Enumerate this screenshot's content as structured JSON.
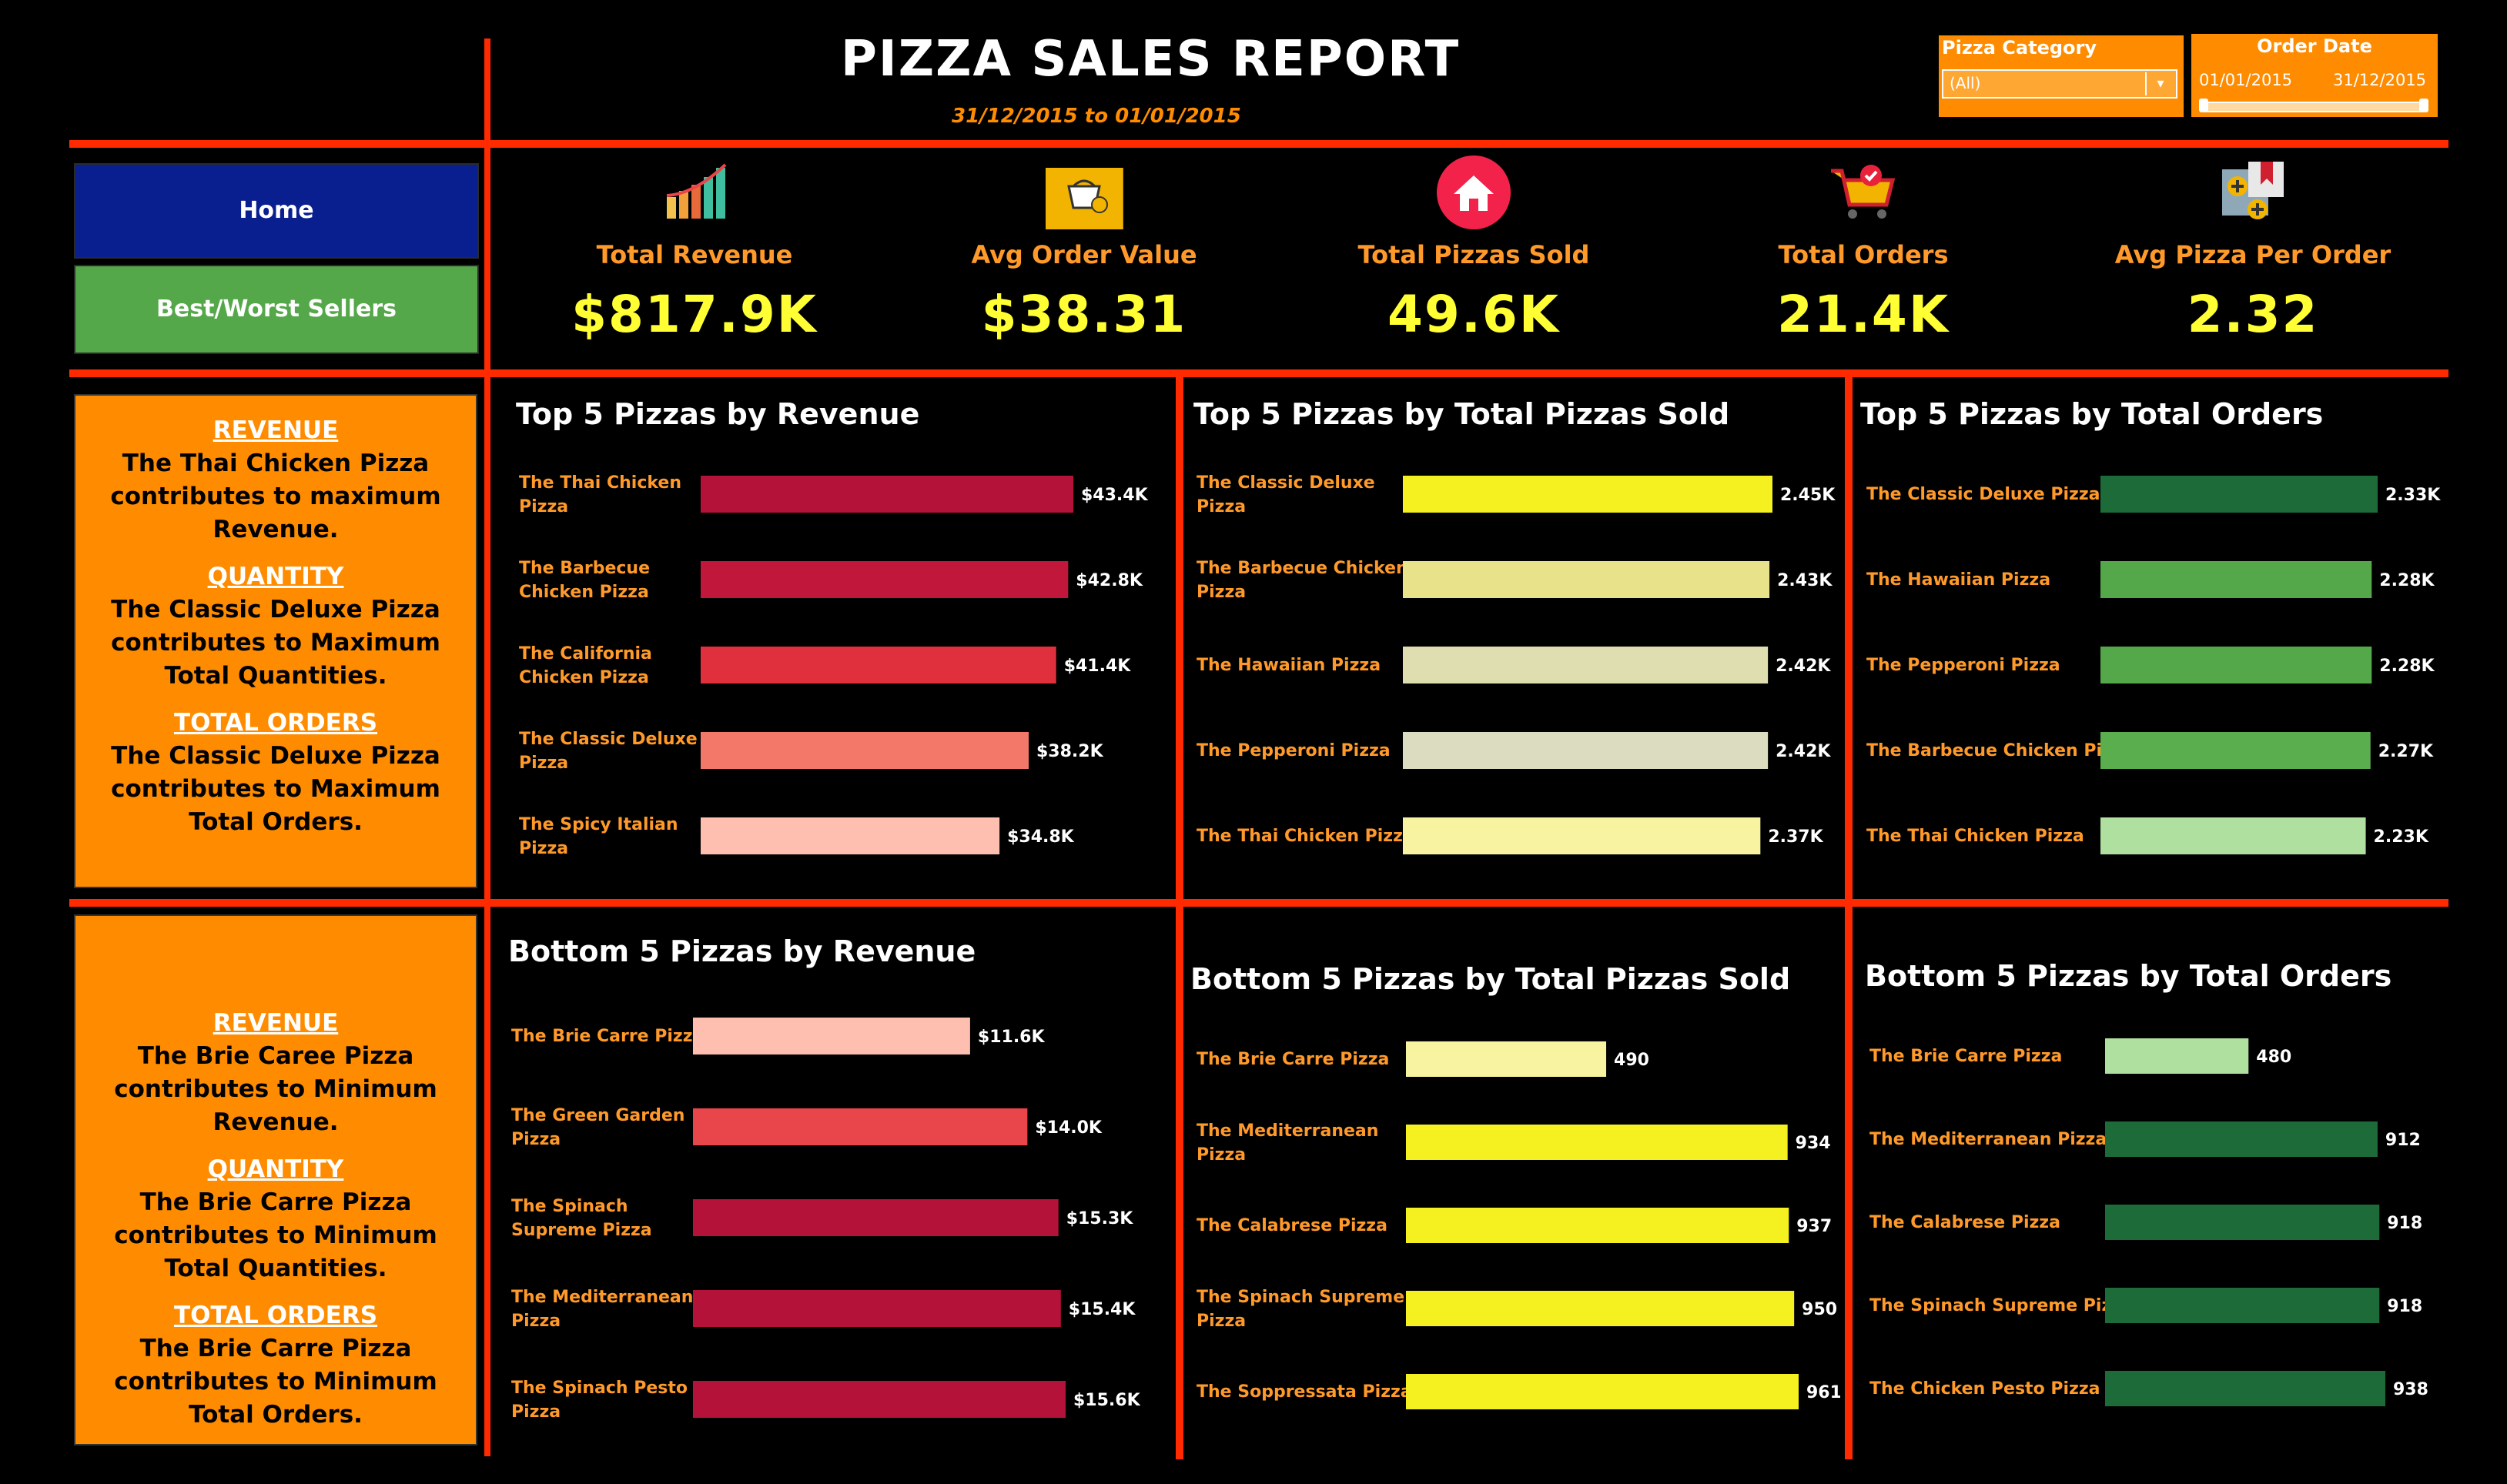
{
  "header": {
    "title": "PIZZA SALES REPORT",
    "date_range": "31/12/2015 to 01/01/2015"
  },
  "filters": {
    "category_label": "Pizza Category",
    "category_value": "(All)",
    "date_label": "Order Date",
    "date_start": "01/01/2015",
    "date_end": "31/12/2015"
  },
  "nav": {
    "home": "Home",
    "best_worst": "Best/Worst Sellers"
  },
  "kpis": [
    {
      "label": "Total Revenue",
      "value": "$817.9K",
      "icon": "bar-chart-icon"
    },
    {
      "label": "Avg Order Value",
      "value": "$38.31",
      "icon": "money-basket-icon"
    },
    {
      "label": "Total Pizzas Sold",
      "value": "49.6K",
      "icon": "home-icon"
    },
    {
      "label": "Total Orders",
      "value": "21.4K",
      "icon": "shopping-cart-icon"
    },
    {
      "label": "Avg Pizza Per Order",
      "value": "2.32",
      "icon": "add-items-icon"
    }
  ],
  "notes_top": {
    "revenue_head": "REVENUE",
    "revenue_text": "The Thai Chicken Pizza contributes to maximum Revenue.",
    "quantity_head": "QUANTITY",
    "quantity_text": "The Classic Deluxe Pizza contributes to Maximum Total Quantities.",
    "orders_head": "TOTAL ORDERS",
    "orders_text": "The Classic Deluxe Pizza contributes to Maximum Total Orders."
  },
  "notes_bottom": {
    "revenue_head": "REVENUE",
    "revenue_text": "The Brie Caree Pizza contributes to Minimum Revenue.",
    "quantity_head": "QUANTITY",
    "quantity_text": "The Brie Carre Pizza contributes to Minimum Total Quantities.",
    "orders_head": "TOTAL ORDERS",
    "orders_text": "The Brie Carre Pizza contributes to Minimum Total Orders."
  },
  "colors": {
    "accent_orange": "#ff8c00",
    "divider_red": "#ff2a00",
    "kpi_yellow": "#ffff33",
    "nav_home": "#0a1f8f",
    "nav_best_worst": "#55a84a"
  },
  "chart_data": [
    {
      "id": "top-revenue",
      "type": "bar",
      "title": "Top 5 Pizzas by Revenue",
      "categories": [
        [
          "The Thai Chicken",
          "Pizza"
        ],
        [
          "The Barbecue",
          "Chicken Pizza"
        ],
        [
          "The California",
          "Chicken Pizza"
        ],
        [
          "The Classic Deluxe",
          "Pizza"
        ],
        [
          "The Spicy Italian",
          "Pizza"
        ]
      ],
      "values": [
        43.4,
        42.8,
        41.4,
        38.2,
        34.8
      ],
      "value_labels": [
        "$43.4K",
        "$42.8K",
        "$41.4K",
        "$38.2K",
        "$34.8K"
      ],
      "unit": "K$",
      "colors": [
        "#b5123a",
        "#c0173a",
        "#e0303e",
        "#f4786a",
        "#ffbfb0"
      ]
    },
    {
      "id": "top-pizzas-sold",
      "type": "bar",
      "title": "Top 5 Pizzas by Total Pizzas Sold",
      "categories": [
        [
          "The Classic Deluxe",
          "Pizza"
        ],
        [
          "The Barbecue Chicken",
          "Pizza"
        ],
        [
          "The Hawaiian Pizza"
        ],
        [
          "The Pepperoni Pizza"
        ],
        [
          "The Thai Chicken Pizza"
        ]
      ],
      "values": [
        2.45,
        2.43,
        2.42,
        2.42,
        2.37
      ],
      "value_labels": [
        "2.45K",
        "2.43K",
        "2.42K",
        "2.42K",
        "2.37K"
      ],
      "colors": [
        "#f5f020",
        "#e8e38a",
        "#dedeb0",
        "#dcdcc0",
        "#f7f3a0"
      ]
    },
    {
      "id": "top-orders",
      "type": "bar",
      "title": "Top 5 Pizzas by Total Orders",
      "categories": [
        [
          "The Classic Deluxe Pizza"
        ],
        [
          "The Hawaiian Pizza"
        ],
        [
          "The Pepperoni Pizza"
        ],
        [
          "The Barbecue Chicken Pizza"
        ],
        [
          "The Thai Chicken Pizza"
        ]
      ],
      "values": [
        2.33,
        2.28,
        2.28,
        2.27,
        2.23
      ],
      "value_labels": [
        "2.33K",
        "2.28K",
        "2.28K",
        "2.27K",
        "2.23K"
      ],
      "colors": [
        "#1e6b3a",
        "#55a84a",
        "#55a84a",
        "#5aae4e",
        "#b0e0a0"
      ]
    },
    {
      "id": "bottom-revenue",
      "type": "bar",
      "title": "Bottom 5 Pizzas by Revenue",
      "categories": [
        [
          "The Brie Carre Pizza"
        ],
        [
          "The Green Garden",
          "Pizza"
        ],
        [
          "The Spinach",
          "Supreme Pizza"
        ],
        [
          "The Mediterranean",
          "Pizza"
        ],
        [
          "The Spinach Pesto",
          "Pizza"
        ]
      ],
      "values": [
        11.6,
        14.0,
        15.3,
        15.4,
        15.6
      ],
      "value_labels": [
        "$11.6K",
        "$14.0K",
        "$15.3K",
        "$15.4K",
        "$15.6K"
      ],
      "colors": [
        "#ffbfb0",
        "#e8464a",
        "#b5123a",
        "#b5123a",
        "#b5123a"
      ]
    },
    {
      "id": "bottom-pizzas-sold",
      "type": "bar",
      "title": "Bottom 5 Pizzas by Total Pizzas Sold",
      "categories": [
        [
          "The Brie Carre Pizza"
        ],
        [
          "The Mediterranean",
          "Pizza"
        ],
        [
          "The Calabrese Pizza"
        ],
        [
          "The Spinach Supreme",
          "Pizza"
        ],
        [
          "The Soppressata Pizza"
        ]
      ],
      "values": [
        490,
        934,
        937,
        950,
        961
      ],
      "value_labels": [
        "490",
        "934",
        "937",
        "950",
        "961"
      ],
      "colors": [
        "#f7f3a0",
        "#f5f020",
        "#f5f020",
        "#f5f020",
        "#f5f020"
      ]
    },
    {
      "id": "bottom-orders",
      "type": "bar",
      "title": "Bottom 5 Pizzas by Total Orders",
      "categories": [
        [
          "The Brie Carre Pizza"
        ],
        [
          "The Mediterranean Pizza"
        ],
        [
          "The Calabrese Pizza"
        ],
        [
          "The Spinach Supreme Pizza"
        ],
        [
          "The Chicken Pesto Pizza"
        ]
      ],
      "values": [
        480,
        912,
        918,
        918,
        938
      ],
      "value_labels": [
        "480",
        "912",
        "918",
        "918",
        "938"
      ],
      "colors": [
        "#b0e0a0",
        "#1e6b3a",
        "#1e6b3a",
        "#1e6b3a",
        "#1e6b3a"
      ]
    }
  ]
}
